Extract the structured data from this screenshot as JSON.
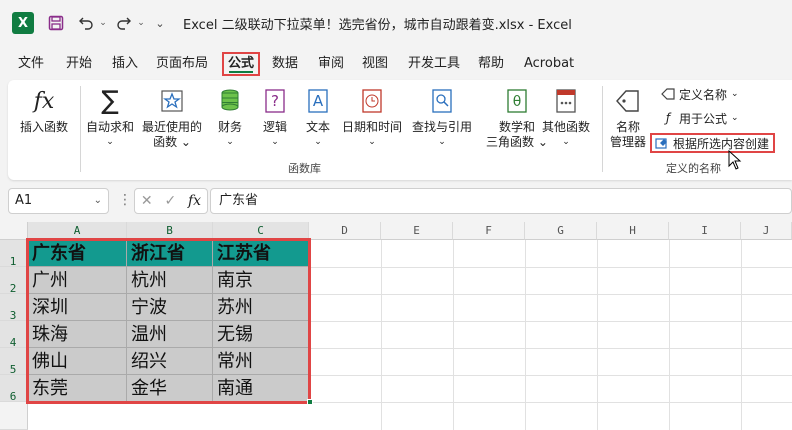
{
  "window": {
    "title": "Excel 二级联动下拉菜单！选完省份，城市自动跟着变.xlsx  -  Excel",
    "logo": "X"
  },
  "tabs": [
    "文件",
    "开始",
    "插入",
    "页面布局",
    "公式",
    "数据",
    "审阅",
    "视图",
    "开发工具",
    "帮助",
    "Acrobat"
  ],
  "ribbon": {
    "insert_function": "插入函数",
    "autosum": "自动求和",
    "recent_1": "最近使用的",
    "recent_2": "函数",
    "financial": "财务",
    "logical": "逻辑",
    "text": "文本",
    "datetime": "日期和时间",
    "lookup": "查找与引用",
    "math_1": "数学和",
    "math_2": "三角函数",
    "other": "其他函数",
    "group_library": "函数库",
    "name_manager_1": "名称",
    "name_manager_2": "管理器",
    "define_name": "定义名称",
    "use_in_formula": "用于公式",
    "create_from_selection": "根据所选内容创建",
    "group_defined_names": "定义的名称"
  },
  "formula_bar": {
    "name_box": "A1",
    "fx": "fx",
    "content": "广东省"
  },
  "grid": {
    "columns": [
      "A",
      "B",
      "C",
      "D",
      "E",
      "F",
      "G",
      "H",
      "I",
      "J"
    ],
    "rows": [
      "1",
      "2",
      "3",
      "4",
      "5",
      "6"
    ],
    "headers": [
      "广东省",
      "浙江省",
      "江苏省"
    ],
    "data": [
      [
        "广州",
        "杭州",
        "南京"
      ],
      [
        "深圳",
        "宁波",
        "苏州"
      ],
      [
        "珠海",
        "温州",
        "无锡"
      ],
      [
        "佛山",
        "绍兴",
        "常州"
      ],
      [
        "东莞",
        "金华",
        "南通"
      ]
    ]
  },
  "colors": {
    "accent": "#107c41",
    "highlight": "#e04545",
    "header_fill": "#139a8f",
    "body_fill": "#cbcbcb"
  }
}
